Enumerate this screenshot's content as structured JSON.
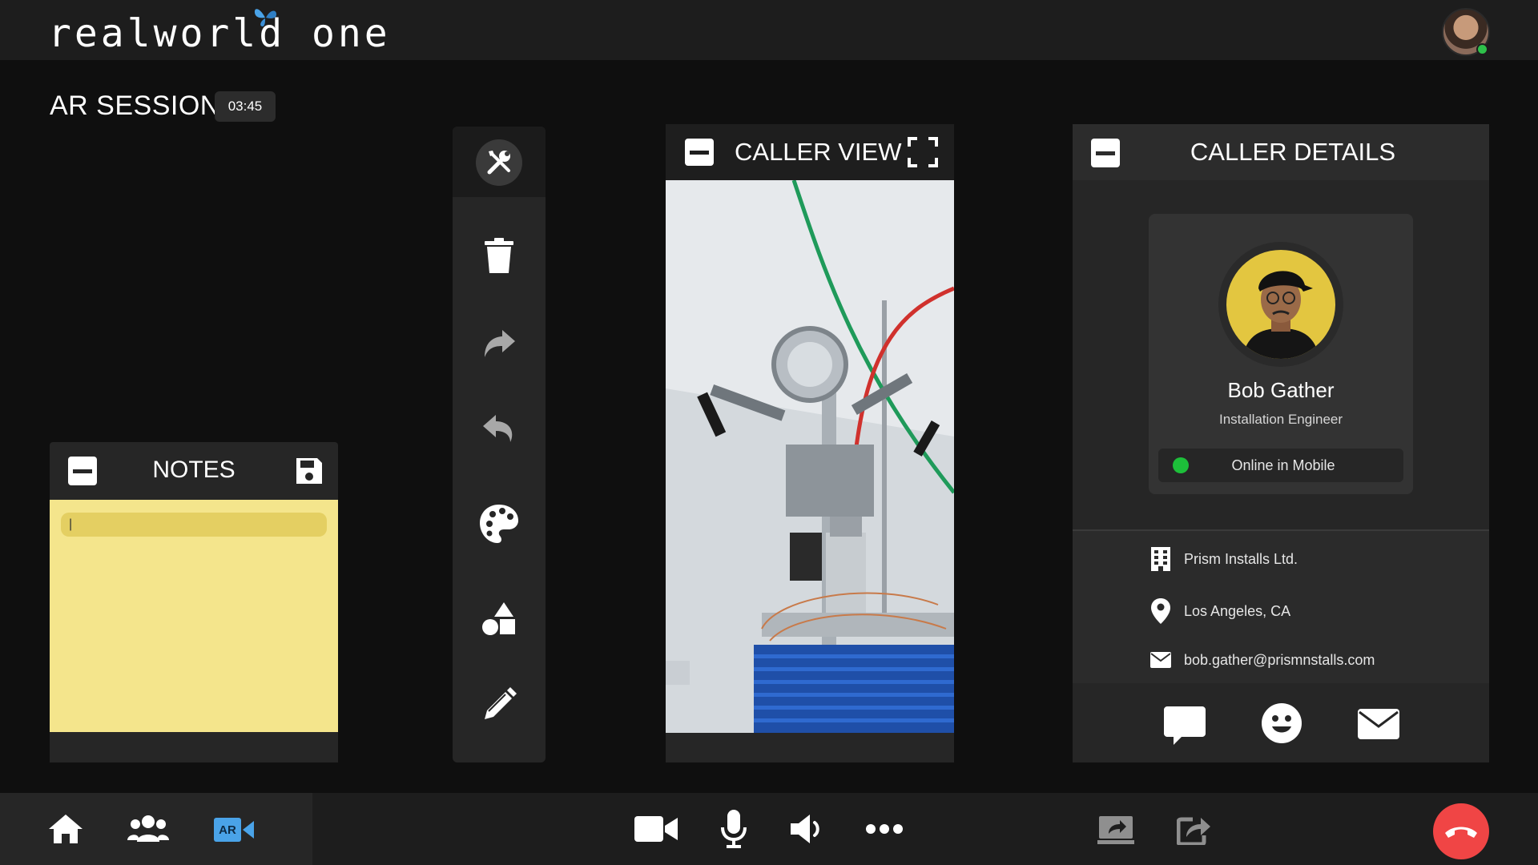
{
  "app": {
    "logo_text": "realworld one"
  },
  "session": {
    "title": "AR SESSION",
    "timer": "03:45"
  },
  "notes": {
    "title": "NOTES",
    "input_value": "|"
  },
  "caller_view": {
    "title": "CALLER VIEW"
  },
  "caller_details": {
    "title": "CALLER DETAILS",
    "name": "Bob Gather",
    "role": "Installation Engineer",
    "status": "Online in Mobile",
    "company": "Prism Installs Ltd.",
    "location": "Los Angeles, CA",
    "email": "bob.gather@prismnstalls.com"
  },
  "bottom_bar": {
    "ar_label": "AR"
  },
  "colors": {
    "accent_blue": "#4aa3e8",
    "notes_yellow": "#f4e58c",
    "online_green": "#1dbf3a",
    "end_call_red": "#f04545"
  },
  "icons": {
    "toolbar": [
      "tools-icon",
      "trash-icon",
      "redo-icon",
      "undo-icon",
      "palette-icon",
      "shapes-icon",
      "pencil-icon"
    ],
    "bottom_left": [
      "home-icon",
      "users-icon",
      "ar-video-icon"
    ],
    "bottom_center": [
      "video-camera-icon",
      "microphone-icon",
      "speaker-icon",
      "more-icon"
    ],
    "bottom_right": [
      "screen-share-icon",
      "share-icon",
      "end-call-icon"
    ]
  }
}
